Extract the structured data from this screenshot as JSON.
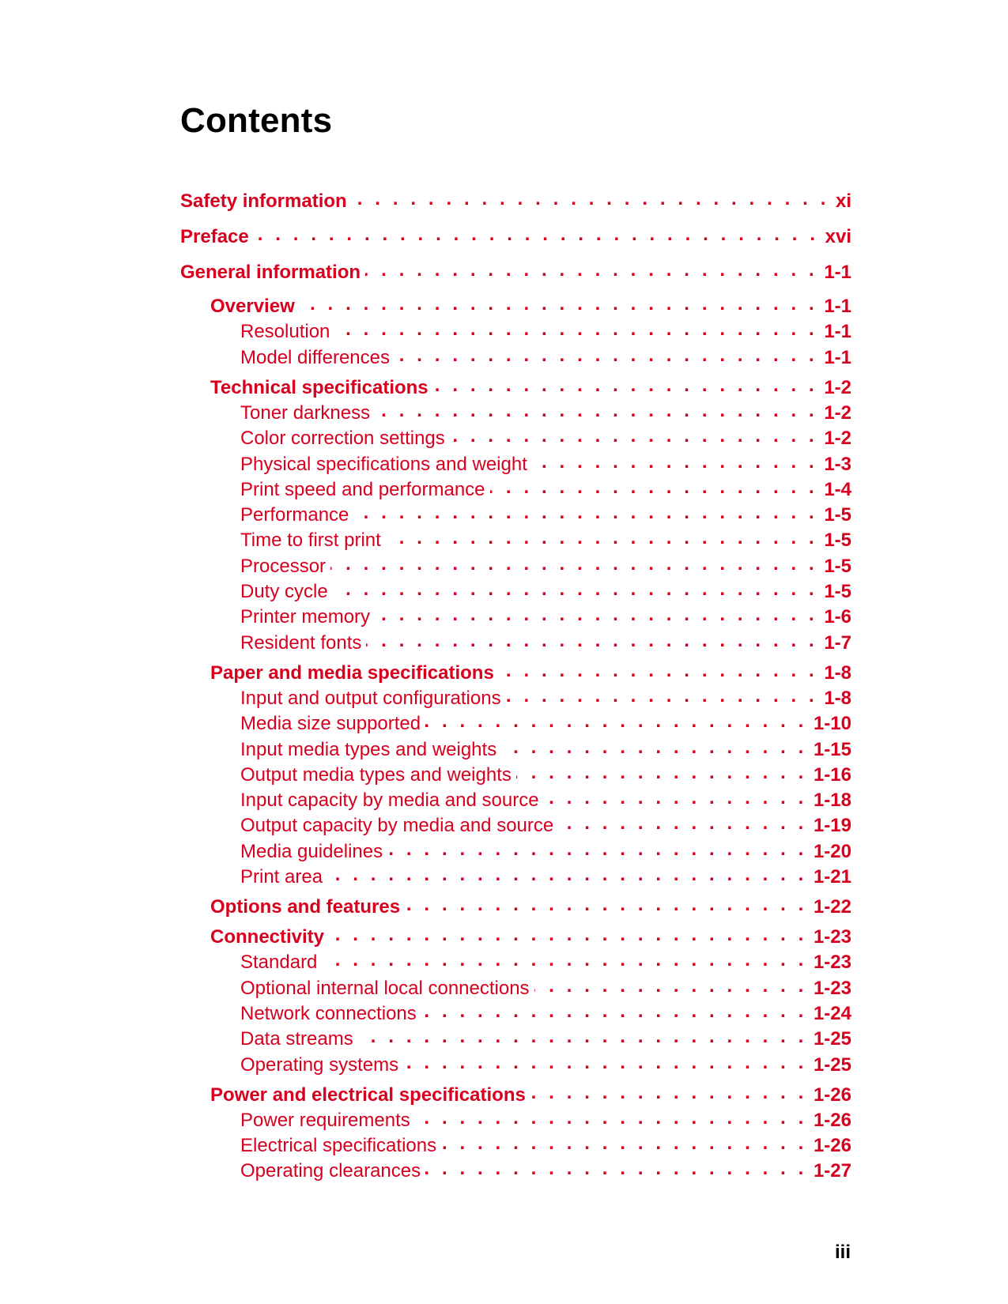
{
  "page": {
    "title": "Contents",
    "page_number": "iii",
    "accent_color": "#d7001e"
  },
  "toc": [
    {
      "level": 1,
      "label": "Safety information",
      "page": "xi"
    },
    {
      "level": 1,
      "label": "Preface",
      "page": "xvi"
    },
    {
      "level": 1,
      "label": "General information",
      "page": "1-1"
    },
    {
      "level": 2,
      "label": "Overview",
      "page": "1-1"
    },
    {
      "level": 3,
      "label": "Resolution",
      "page": "1-1"
    },
    {
      "level": 3,
      "label": "Model differences",
      "page": "1-1"
    },
    {
      "level": 2,
      "label": "Technical specifications",
      "page": "1-2"
    },
    {
      "level": 3,
      "label": "Toner darkness",
      "page": "1-2"
    },
    {
      "level": 3,
      "label": "Color correction settings",
      "page": "1-2"
    },
    {
      "level": 3,
      "label": "Physical specifications and weight",
      "page": "1-3"
    },
    {
      "level": 3,
      "label": "Print speed and performance",
      "page": "1-4"
    },
    {
      "level": 3,
      "label": "Performance",
      "page": "1-5"
    },
    {
      "level": 3,
      "label": "Time to first print",
      "page": "1-5"
    },
    {
      "level": 3,
      "label": "Processor",
      "page": "1-5"
    },
    {
      "level": 3,
      "label": "Duty cycle",
      "page": "1-5"
    },
    {
      "level": 3,
      "label": "Printer memory",
      "page": "1-6"
    },
    {
      "level": 3,
      "label": "Resident fonts",
      "page": "1-7"
    },
    {
      "level": 2,
      "label": "Paper and media specifications",
      "page": "1-8"
    },
    {
      "level": 3,
      "label": "Input and output configurations",
      "page": "1-8"
    },
    {
      "level": 3,
      "label": "Media size supported",
      "page": "1-10"
    },
    {
      "level": 3,
      "label": "Input media types and weights",
      "page": "1-15"
    },
    {
      "level": 3,
      "label": "Output media types and weights",
      "page": "1-16"
    },
    {
      "level": 3,
      "label": "Input capacity by media and source",
      "page": "1-18"
    },
    {
      "level": 3,
      "label": "Output capacity by media and source",
      "page": "1-19"
    },
    {
      "level": 3,
      "label": "Media guidelines",
      "page": "1-20"
    },
    {
      "level": 3,
      "label": "Print area",
      "page": "1-21"
    },
    {
      "level": 2,
      "label": "Options and features",
      "page": "1-22"
    },
    {
      "level": 2,
      "label": "Connectivity",
      "page": "1-23"
    },
    {
      "level": 3,
      "label": "Standard",
      "page": "1-23"
    },
    {
      "level": 3,
      "label": "Optional internal local connections",
      "page": "1-23"
    },
    {
      "level": 3,
      "label": "Network connections",
      "page": "1-24"
    },
    {
      "level": 3,
      "label": "Data streams",
      "page": "1-25"
    },
    {
      "level": 3,
      "label": "Operating systems",
      "page": "1-25"
    },
    {
      "level": 2,
      "label": "Power and electrical specifications",
      "page": "1-26"
    },
    {
      "level": 3,
      "label": "Power requirements",
      "page": "1-26"
    },
    {
      "level": 3,
      "label": "Electrical specifications",
      "page": "1-26"
    },
    {
      "level": 3,
      "label": "Operating clearances",
      "page": "1-27"
    }
  ]
}
